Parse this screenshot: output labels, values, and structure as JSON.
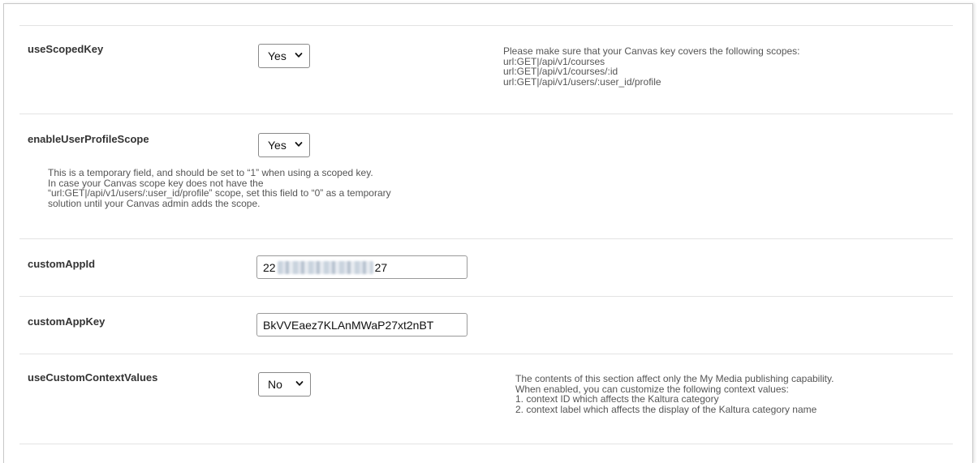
{
  "rows": [
    {
      "label": "useScopedKey",
      "select_value": "Yes",
      "note_lines": [
        "Please make sure that your Canvas key covers the following scopes:",
        "url:GET|/api/v1/courses",
        "url:GET|/api/v1/courses/:id",
        "url:GET|/api/v1/users/:user_id/profile"
      ]
    },
    {
      "label": "enableUserProfileScope",
      "select_value": "Yes",
      "help_lines": [
        "This is a temporary field, and should be set to “1” when using a scoped key.",
        "In case your Canvas scope key does not have the",
        "“url:GET|/api/v1/users/:user_id/profile” scope, set this field to “0” as a temporary",
        "solution until your Canvas admin adds the scope."
      ]
    },
    {
      "label": "customAppId",
      "input_prefix": "22",
      "input_suffix": "27"
    },
    {
      "label": "customAppKey",
      "input_value": "BkVVEaez7KLAnMWaP27xt2nBT"
    },
    {
      "label": "useCustomContextValues",
      "select_value": "No",
      "note_lines": [
        "The contents of this section affect only the My Media publishing capability.",
        "When enabled, you can customize the following context values:",
        "1. context ID which affects the Kaltura category",
        "2. context label which affects the display of the Kaltura category name"
      ]
    }
  ],
  "icons": {
    "dropdown": "chevron-down-icon"
  }
}
